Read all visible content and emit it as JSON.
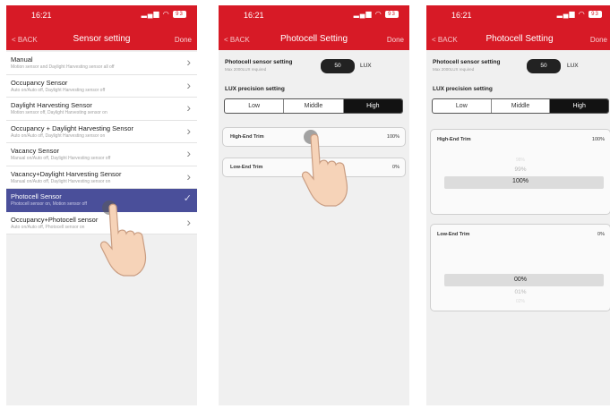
{
  "status": {
    "time": "16:21",
    "battery": "93"
  },
  "screen1": {
    "back": "< BACK",
    "title": "Sensor setting",
    "done": "Done",
    "items": [
      {
        "title": "Manual",
        "subtitle": "Motion sensor and Daylight Harvesting sensor all off",
        "selected": false
      },
      {
        "title": "Occupancy Sensor",
        "subtitle": "Auto on/Auto off, Daylight Harvesting sensor off",
        "selected": false
      },
      {
        "title": "Daylight Harvesting Sensor",
        "subtitle": "Motion sensor off, Daylight Harvesting sensor on",
        "selected": false
      },
      {
        "title": "Occupancy + Daylight Harvesting Sensor",
        "subtitle": "Auto on/Auto off, Daylight Harvesting sensor on",
        "selected": false
      },
      {
        "title": "Vacancy Sensor",
        "subtitle": "Manual on/Auto off, Daylight Harvesting sensor off",
        "selected": false
      },
      {
        "title": "Vacancy+Daylight Harvesting Sensor",
        "subtitle": "Manual on/Auto off, Daylight Harvesting sensor on",
        "selected": false
      },
      {
        "title": "Photocell Sensor",
        "subtitle": "Photocell sensor on, Motion sensor off",
        "selected": true
      },
      {
        "title": "Occupancy+Photocell sensor",
        "subtitle": "Auto on/Auto off, Photocell sensor on",
        "selected": false
      }
    ]
  },
  "screen2": {
    "back": "< BACK",
    "title": "Photocell Setting",
    "done": "Done",
    "sensor_label": "Photocell sensor setting",
    "sensor_sub": "Max 2000LUX required",
    "lux_value": "50",
    "lux_unit": "LUX",
    "precision_label": "LUX precision setting",
    "segments": [
      "Low",
      "Middle",
      "High"
    ],
    "active_segment": "High",
    "high_trim_label": "High-End Trim",
    "high_trim_value": "100%",
    "low_trim_label": "Low-End Trim",
    "low_trim_value": "0%"
  },
  "screen3": {
    "back": "< BACK",
    "title": "Photocell Setting",
    "done": "Done",
    "sensor_label": "Photocell sensor setting",
    "sensor_sub": "Max 2000LUX required",
    "lux_value": "50",
    "lux_unit": "LUX",
    "precision_label": "LUX precision setting",
    "segments": [
      "Low",
      "Middle",
      "High"
    ],
    "active_segment": "High",
    "high_trim_label": "High-End Trim",
    "high_trim_value": "100%",
    "high_picker": [
      "98%",
      "99%",
      "100%"
    ],
    "low_trim_label": "Low-End Trim",
    "low_trim_value": "0%",
    "low_picker": [
      "00%",
      "01%",
      "02%"
    ]
  }
}
